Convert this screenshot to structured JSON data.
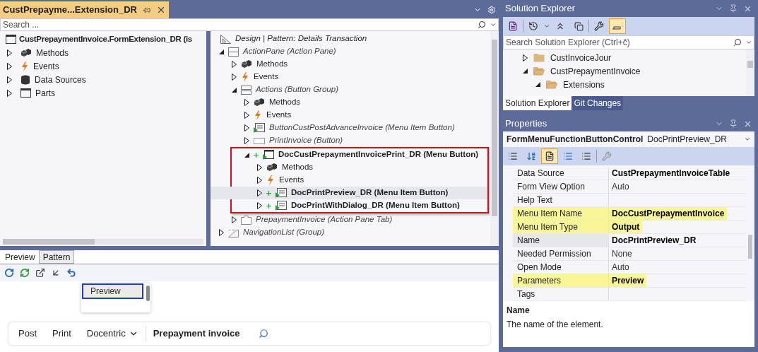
{
  "document_tab": {
    "title": "CustPrepayme...Extension_DR"
  },
  "search": {
    "placeholder": "Search ..."
  },
  "element_tree": {
    "root": "CustPrepaymentInvoice.FormExtension_DR (is",
    "children": [
      {
        "label": "Methods",
        "kind": "methods",
        "expanded": false
      },
      {
        "label": "Events",
        "kind": "events",
        "expanded": false
      },
      {
        "label": "Data Sources",
        "kind": "data-sources",
        "expanded": false
      },
      {
        "label": "Parts",
        "kind": "parts",
        "expanded": false
      }
    ]
  },
  "designer": {
    "root": "Design | Pattern: Details Transaction",
    "children": [
      {
        "label": "ActionPane (Action Pane)",
        "kind": "pane",
        "expanded": true,
        "italic": true,
        "added": false,
        "highlighted": false,
        "selected": false,
        "children": [
          {
            "label": "Methods",
            "kind": "methods",
            "expanded": false,
            "italic": false,
            "added": false,
            "highlighted": false,
            "selected": false
          },
          {
            "label": "Events",
            "kind": "events",
            "expanded": false,
            "italic": false,
            "added": false,
            "highlighted": false,
            "selected": false
          },
          {
            "label": "Actions (Button Group)",
            "kind": "group",
            "expanded": true,
            "italic": true,
            "added": false,
            "highlighted": false,
            "selected": false,
            "children": [
              {
                "label": "Methods",
                "kind": "methods",
                "expanded": false,
                "italic": false,
                "added": false,
                "highlighted": false,
                "selected": false
              },
              {
                "label": "Events",
                "kind": "events",
                "expanded": false,
                "italic": false,
                "added": false,
                "highlighted": false,
                "selected": false
              },
              {
                "label": "ButtonCustPostAdvanceInvoice (Menu Item Button)",
                "kind": "menu-item-button",
                "expanded": false,
                "italic": true,
                "added": false,
                "highlighted": false,
                "selected": false
              },
              {
                "label": "PrintInvoice (Button)",
                "kind": "button",
                "expanded": false,
                "italic": true,
                "added": false,
                "highlighted": false,
                "selected": false
              },
              {
                "label": "DocCustPrepaymentInvoicePrint_DR (Menu Button)",
                "kind": "menu-button",
                "expanded": true,
                "italic": false,
                "added": true,
                "highlighted": true,
                "selected": false,
                "children": [
                  {
                    "label": "Methods",
                    "kind": "methods",
                    "expanded": false,
                    "italic": false,
                    "added": false,
                    "highlighted": false,
                    "selected": false
                  },
                  {
                    "label": "Events",
                    "kind": "events",
                    "expanded": false,
                    "italic": false,
                    "added": false,
                    "highlighted": false,
                    "selected": false
                  },
                  {
                    "label": "DocPrintPreview_DR (Menu Item Button)",
                    "kind": "menu-item-button",
                    "expanded": false,
                    "italic": false,
                    "added": true,
                    "highlighted": false,
                    "selected": true
                  },
                  {
                    "label": "DocPrintWithDialog_DR (Menu Item Button)",
                    "kind": "menu-item-button",
                    "expanded": false,
                    "italic": false,
                    "added": true,
                    "highlighted": false,
                    "selected": false
                  }
                ]
              }
            ]
          },
          {
            "label": "PrepaymentInvoice (Action Pane Tab)",
            "kind": "tab",
            "expanded": false,
            "italic": true,
            "added": false,
            "highlighted": false,
            "selected": false
          }
        ]
      },
      {
        "label": "NavigationList (Group)",
        "kind": "nav-group",
        "expanded": false,
        "italic": true,
        "added": false,
        "highlighted": false,
        "selected": false
      }
    ]
  },
  "bottom_tabs": [
    {
      "label": "Preview",
      "selected": true
    },
    {
      "label": "Pattern",
      "selected": false
    }
  ],
  "preview": {
    "dropdown_items": [
      {
        "label": "Preview",
        "selected": true
      }
    ],
    "action_bar": [
      {
        "label": "Post",
        "kind": "button"
      },
      {
        "label": "Print",
        "kind": "button"
      },
      {
        "label": "Docentric",
        "kind": "menu"
      },
      {
        "label": "Prepayment invoice",
        "kind": "title"
      }
    ]
  },
  "solution_explorer": {
    "title": "Solution Explorer",
    "search": {
      "placeholder": "Search Solution Explorer (Ctrl+č)"
    },
    "tree": [
      {
        "label": "CustInvoiceJour",
        "expanded": false
      },
      {
        "label": "CustPrepaymentInvoice",
        "expanded": true,
        "children": [
          {
            "label": "Extensions",
            "expanded": true
          }
        ]
      }
    ],
    "tabs": [
      {
        "label": "Solution Explorer",
        "selected": true
      },
      {
        "label": "Git Changes",
        "selected": false
      }
    ]
  },
  "properties": {
    "title": "Properties",
    "object_type": "FormMenuFunctionButtonControl",
    "object_name": "DocPrintPreview_DR",
    "rows": [
      {
        "name": "Data Source",
        "value": "CustPrepaymentInvoiceTable",
        "modified": true,
        "highlighted": false,
        "selected": false
      },
      {
        "name": "Form View Option",
        "value": "Auto",
        "modified": false,
        "highlighted": false,
        "selected": false
      },
      {
        "name": "Help Text",
        "value": "",
        "highlighted": false,
        "selected": false
      },
      {
        "name": "Menu Item Name",
        "value": "DocCustPrepaymentInvoice",
        "modified": true,
        "highlighted": true,
        "selected": false
      },
      {
        "name": "Menu Item Type",
        "value": "Output",
        "modified": true,
        "highlighted": true,
        "selected": false
      },
      {
        "name": "Name",
        "value": "DocPrintPreview_DR",
        "modified": true,
        "highlighted": false,
        "selected": true
      },
      {
        "name": "Needed Permission",
        "value": "None",
        "modified": false,
        "highlighted": false,
        "selected": false
      },
      {
        "name": "Open Mode",
        "value": "Auto",
        "modified": false,
        "highlighted": false,
        "selected": false
      },
      {
        "name": "Parameters",
        "value": "Preview",
        "modified": true,
        "highlighted": true,
        "selected": false
      },
      {
        "name": "Tags",
        "value": "",
        "highlighted": false,
        "selected": false
      }
    ],
    "description": {
      "title": "Name",
      "text": "The name of the element."
    }
  }
}
